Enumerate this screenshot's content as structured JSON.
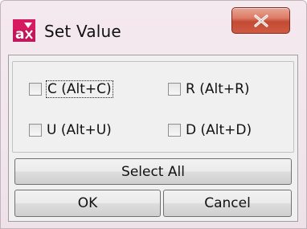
{
  "window": {
    "title": "Set Value",
    "icon": "app-icon",
    "close_icon": "close-icon"
  },
  "checkboxes": [
    {
      "label": "C (Alt+C)",
      "checked": false,
      "focused": true
    },
    {
      "label": "R (Alt+R)",
      "checked": false,
      "focused": false
    },
    {
      "label": "U (Alt+U)",
      "checked": false,
      "focused": false
    },
    {
      "label": "D (Alt+D)",
      "checked": false,
      "focused": false
    }
  ],
  "buttons": {
    "select_all": "Select All",
    "ok": "OK",
    "cancel": "Cancel"
  },
  "colors": {
    "title_bar": "#f1e6ec",
    "close_button": "#c44a34",
    "dialog_face": "#f0f0f0"
  }
}
